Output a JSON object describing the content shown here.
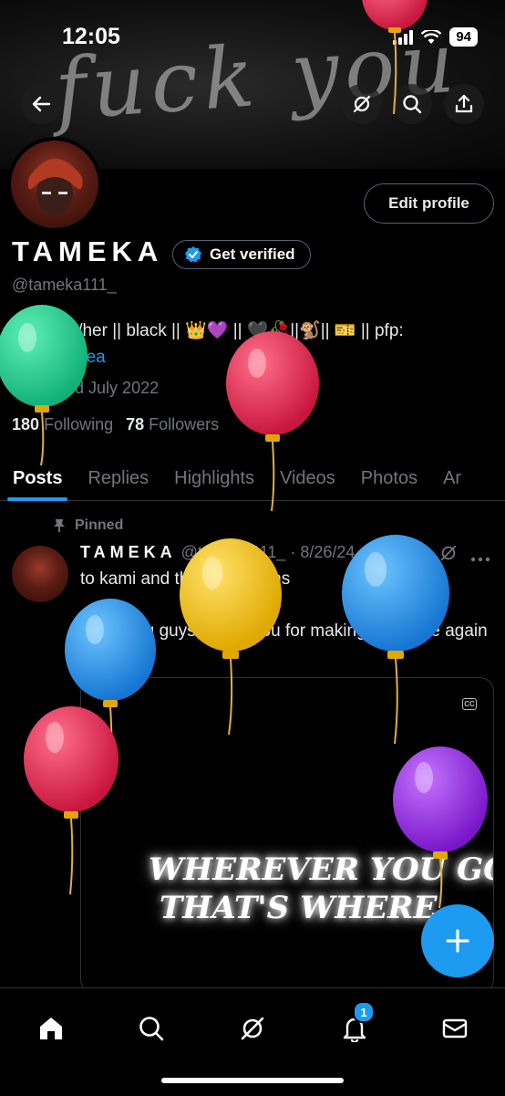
{
  "status_bar": {
    "time": "12:05",
    "battery": "94"
  },
  "banner": {
    "graffiti_text": "fuck you"
  },
  "profile": {
    "edit_button": "Edit profile",
    "display_name": "TAMEKA",
    "get_verified": "Get verified",
    "handle": "@tameka111_",
    "bio_text": "21 || she/her || black || 👑💜 || 🖤🥀||🐒|| 🎫 || pfp: ",
    "bio_link": "@munchtea",
    "joined": "Joined July 2022",
    "following_count": "180",
    "following_label": "Following",
    "followers_count": "78",
    "followers_label": "Followers"
  },
  "tabs": [
    "Posts",
    "Replies",
    "Highlights",
    "Videos",
    "Photos",
    "Ar"
  ],
  "post": {
    "pinned_label": "Pinned",
    "author_name": "TAMEKA",
    "author_meta": "@tameka111_ · 8/26/24",
    "text_line1": "to kami and the obsessions",
    "text_line2": "I love you guys, thank you for making me smile again",
    "media_caption_line1": "WHEREVER YOU GO",
    "media_caption_line2": "THAT'S WHERE",
    "cc_label": "CC"
  },
  "bottom_nav": {
    "notifications_badge": "1"
  },
  "colors": {
    "accent": "#1d9bf0",
    "background": "#000000",
    "muted": "#71767b"
  },
  "icons": [
    "back-arrow-icon",
    "grok-icon",
    "search-icon",
    "share-icon",
    "verified-check-icon",
    "calendar-icon",
    "pin-icon",
    "home-icon",
    "notifications-icon",
    "mail-icon",
    "plus-icon",
    "more-icon"
  ]
}
